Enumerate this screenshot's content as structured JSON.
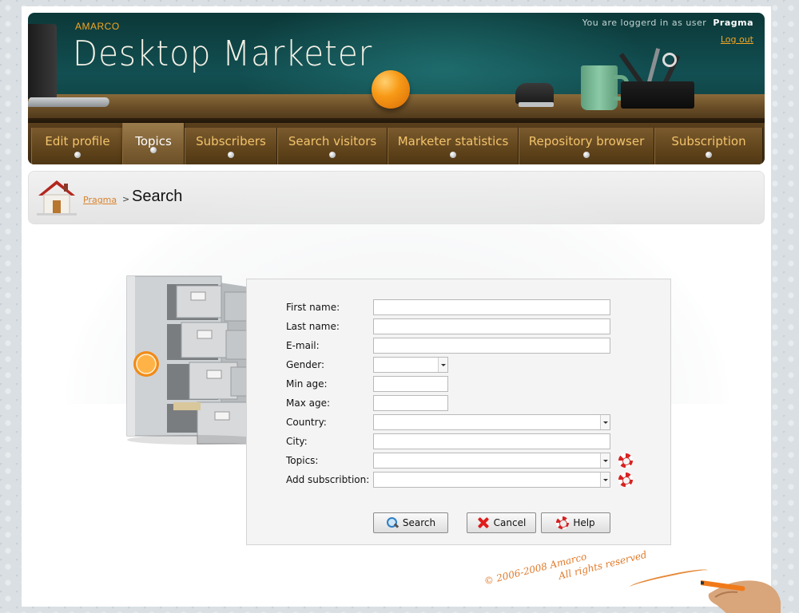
{
  "header": {
    "brand_small": "AMARCO",
    "brand_big": "Desktop Marketer",
    "login_prefix": "You are loggerd in as user",
    "username": "Pragma",
    "logout_label": "Log out"
  },
  "nav": {
    "tabs": [
      {
        "label": "Edit profile",
        "active": false
      },
      {
        "label": "Topics",
        "active": true
      },
      {
        "label": "Subscribers",
        "active": false
      },
      {
        "label": "Search visitors",
        "active": false
      },
      {
        "label": "Marketer statistics",
        "active": false
      },
      {
        "label": "Repository browser",
        "active": false
      },
      {
        "label": "Subscription",
        "active": false
      }
    ]
  },
  "breadcrumb": {
    "link": "Pragma",
    "separator": ">",
    "title": "Search"
  },
  "form": {
    "fields": {
      "first_name": {
        "label": "First name:",
        "value": ""
      },
      "last_name": {
        "label": "Last name:",
        "value": ""
      },
      "email": {
        "label": "E-mail:",
        "value": ""
      },
      "gender": {
        "label": "Gender:",
        "value": ""
      },
      "min_age": {
        "label": "Min age:",
        "value": ""
      },
      "max_age": {
        "label": "Max age:",
        "value": ""
      },
      "country": {
        "label": "Country:",
        "value": ""
      },
      "city": {
        "label": "City:",
        "value": ""
      },
      "topics": {
        "label": "Topics:",
        "value": ""
      },
      "add_subscription": {
        "label": "Add subscribtion:",
        "value": ""
      }
    },
    "buttons": {
      "search": "Search",
      "cancel": "Cancel",
      "help": "Help"
    }
  },
  "footer": {
    "copyright_line1": "© 2006-2008 Amarco",
    "copyright_line2": "All rights reserved"
  },
  "colors": {
    "accent_orange": "#f5a623",
    "header_teal": "#124f52",
    "nav_brown": "#5d4119"
  }
}
